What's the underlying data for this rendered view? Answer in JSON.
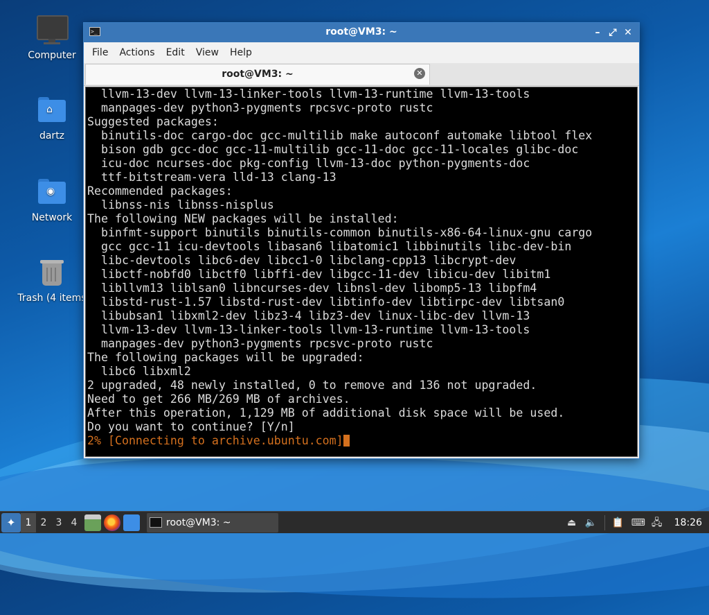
{
  "desktop": {
    "icons": [
      {
        "label": "Computer",
        "icon": "computer-icon"
      },
      {
        "label": "dartz",
        "icon": "home-folder-icon"
      },
      {
        "label": "Network",
        "icon": "network-folder-icon"
      },
      {
        "label": "Trash (4 items",
        "icon": "trash-icon"
      }
    ]
  },
  "window": {
    "title": "root@VM3: ~",
    "menu": [
      "File",
      "Actions",
      "Edit",
      "View",
      "Help"
    ],
    "tab_title": "root@VM3: ~",
    "accent": "#3a77b8"
  },
  "terminal": {
    "lines": [
      "  llvm-13-dev llvm-13-linker-tools llvm-13-runtime llvm-13-tools",
      "  manpages-dev python3-pygments rpcsvc-proto rustc",
      "Suggested packages:",
      "  binutils-doc cargo-doc gcc-multilib make autoconf automake libtool flex",
      "  bison gdb gcc-doc gcc-11-multilib gcc-11-doc gcc-11-locales glibc-doc",
      "  icu-doc ncurses-doc pkg-config llvm-13-doc python-pygments-doc",
      "  ttf-bitstream-vera lld-13 clang-13",
      "Recommended packages:",
      "  libnss-nis libnss-nisplus",
      "The following NEW packages will be installed:",
      "  binfmt-support binutils binutils-common binutils-x86-64-linux-gnu cargo",
      "  gcc gcc-11 icu-devtools libasan6 libatomic1 libbinutils libc-dev-bin",
      "  libc-devtools libc6-dev libcc1-0 libclang-cpp13 libcrypt-dev",
      "  libctf-nobfd0 libctf0 libffi-dev libgcc-11-dev libicu-dev libitm1",
      "  libllvm13 liblsan0 libncurses-dev libnsl-dev libomp5-13 libpfm4",
      "  libstd-rust-1.57 libstd-rust-dev libtinfo-dev libtirpc-dev libtsan0",
      "  libubsan1 libxml2-dev libz3-4 libz3-dev linux-libc-dev llvm-13",
      "  llvm-13-dev llvm-13-linker-tools llvm-13-runtime llvm-13-tools",
      "  manpages-dev python3-pygments rpcsvc-proto rustc",
      "The following packages will be upgraded:",
      "  libc6 libxml2",
      "2 upgraded, 48 newly installed, 0 to remove and 136 not upgraded.",
      "Need to get 266 MB/269 MB of archives.",
      "After this operation, 1,129 MB of additional disk space will be used.",
      "Do you want to continue? [Y/n]"
    ],
    "progress_line": "2% [Connecting to archive.ubuntu.com]",
    "progress_color": "#d4701e"
  },
  "taskbar": {
    "workspaces": [
      "1",
      "2",
      "3",
      "4"
    ],
    "active_workspace": "1",
    "task_label": "root@VM3: ~",
    "clock": "18:26"
  }
}
